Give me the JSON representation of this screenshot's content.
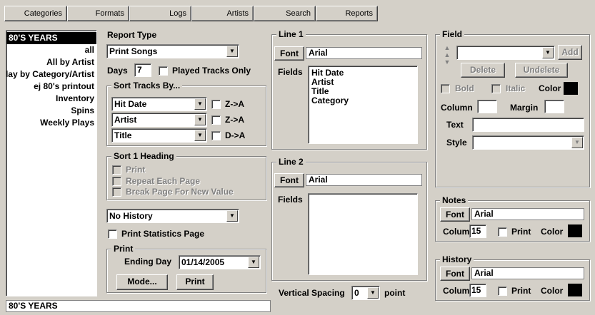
{
  "toolbar": {
    "categories": "Categories",
    "formats": "Formats",
    "logs": "Logs",
    "artists": "Artists",
    "search": "Search",
    "reports": "Reports"
  },
  "report_list": {
    "items": [
      "80'S YEARS",
      "all",
      "All by Artist",
      "Play by Category/Artist",
      "ej 80's printout",
      "Inventory",
      "Spins",
      "Weekly Plays"
    ],
    "selected": "80'S YEARS"
  },
  "report_type": {
    "label": "Report Type",
    "value": "Print Songs",
    "days_label": "Days",
    "days_value": "7",
    "played_only_label": "Played Tracks Only"
  },
  "sort_tracks": {
    "title": "Sort Tracks By...",
    "rows": [
      {
        "field": "Hit Date",
        "dir_label": "Z->A"
      },
      {
        "field": "Artist",
        "dir_label": "Z->A"
      },
      {
        "field": "Title",
        "dir_label": "D->A"
      }
    ]
  },
  "sort_heading": {
    "title": "Sort 1 Heading",
    "print": "Print",
    "repeat": "Repeat Each Page",
    "break": "Break Page For New Value"
  },
  "history_select": "No History",
  "print_stats_label": "Print Statistics Page",
  "print_group": {
    "title": "Print",
    "ending_day_label": "Ending Day",
    "ending_day_value": "01/14/2005",
    "mode_button": "Mode...",
    "print_button": "Print"
  },
  "line1": {
    "title": "Line 1",
    "font_button": "Font",
    "font_value": "Arial",
    "fields_label": "Fields",
    "fields": [
      "Hit Date",
      "Artist",
      "Title",
      "Category"
    ]
  },
  "line2": {
    "title": "Line 2",
    "font_button": "Font",
    "font_value": "Arial",
    "fields_label": "Fields",
    "fields": []
  },
  "vertical_spacing": {
    "label": "Vertical Spacing",
    "value": "0",
    "unit": "point"
  },
  "field_group": {
    "title": "Field",
    "add": "Add",
    "delete": "Delete",
    "undelete": "Undelete",
    "bold": "Bold",
    "italic": "Italic",
    "color": "Color",
    "column": "Column",
    "margin": "Margin",
    "text": "Text",
    "style": "Style"
  },
  "notes": {
    "title": "Notes",
    "font_button": "Font",
    "font_value": "Arial",
    "colum_label": "Colum",
    "colum_value": "15",
    "print_label": "Print",
    "color_label": "Color"
  },
  "history": {
    "title": "History",
    "font_button": "Font",
    "font_value": "Arial",
    "colum_label": "Colum",
    "colum_value": "15",
    "print_label": "Print",
    "color_label": "Color"
  },
  "status_bar": "80'S YEARS"
}
